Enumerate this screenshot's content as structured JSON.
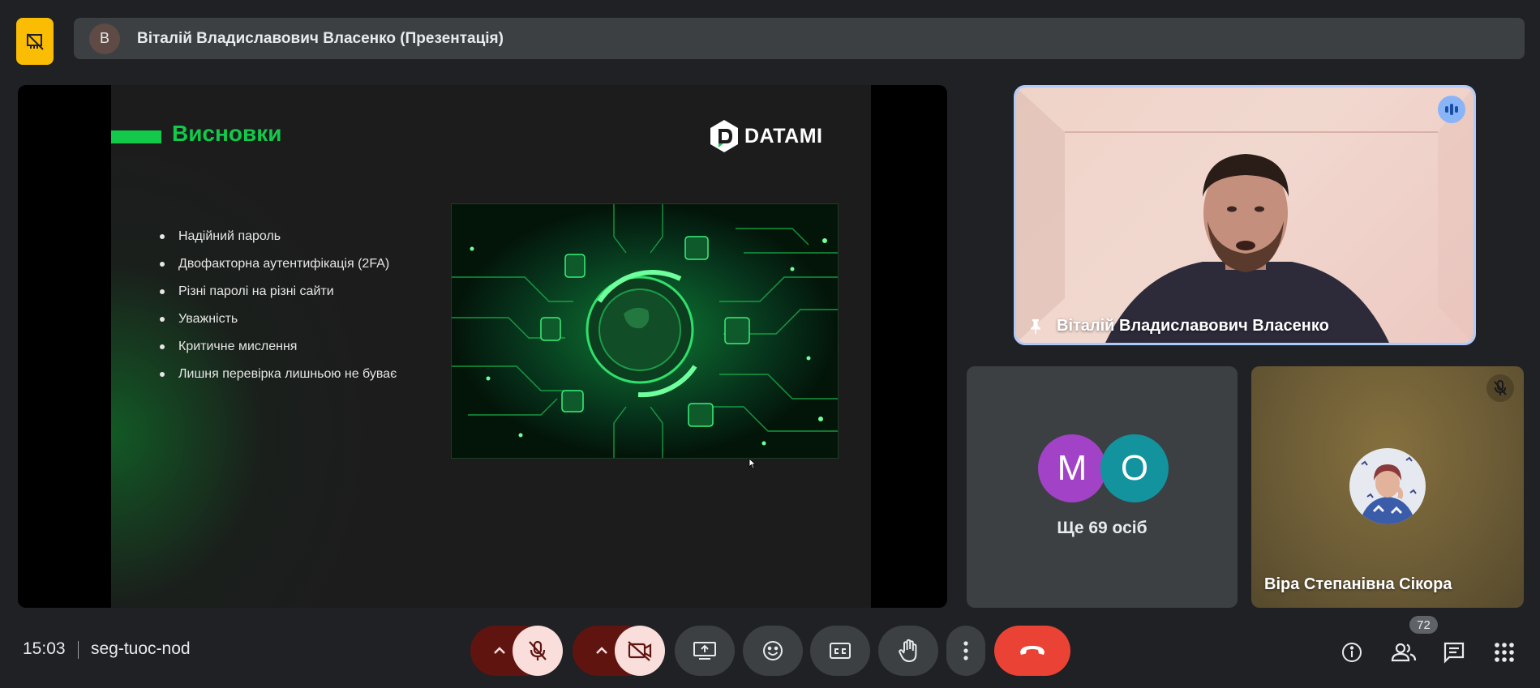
{
  "header": {
    "app_icon": "no-presentation-icon",
    "presenter_initial": "В",
    "title": "Віталій Владиславович Власенко (Презентація)"
  },
  "slide": {
    "title": "Висновки",
    "logo_text": "DATAMI",
    "bullets": [
      "Надійний пароль",
      "Двофакторна аутентифікація (2FA)",
      "Різні паролі на різні сайти",
      "Уважність",
      "Критичне мислення",
      "Лишня перевірка лишньою не буває"
    ]
  },
  "tiles": {
    "main": {
      "name": "Віталій Владиславович Власенко",
      "pin_icon": "pin-icon",
      "speaking_icon": "audio-level-icon"
    },
    "group": {
      "avatars": [
        {
          "initial": "M",
          "color": "#a142c7"
        },
        {
          "initial": "O",
          "color": "#12939e"
        }
      ],
      "more_label": "Ще 69 осіб"
    },
    "vira": {
      "name": "Віра Степанівна Сікора",
      "muted_icon": "mic-off-icon"
    }
  },
  "footer": {
    "time": "15:03",
    "meeting_code": "seg-tuoc-nod",
    "participant_count": "72",
    "controls": [
      "mic-options",
      "mic-off",
      "camera-options",
      "camera-off",
      "present-now",
      "reactions",
      "captions",
      "raise-hand",
      "more-options",
      "leave-call"
    ],
    "right_controls": [
      "meeting-details",
      "people",
      "chat",
      "activities"
    ]
  },
  "colors": {
    "accent_green": "#12c94a",
    "leave_red": "#ea4335",
    "speaking_blue": "#8ab4f8"
  }
}
